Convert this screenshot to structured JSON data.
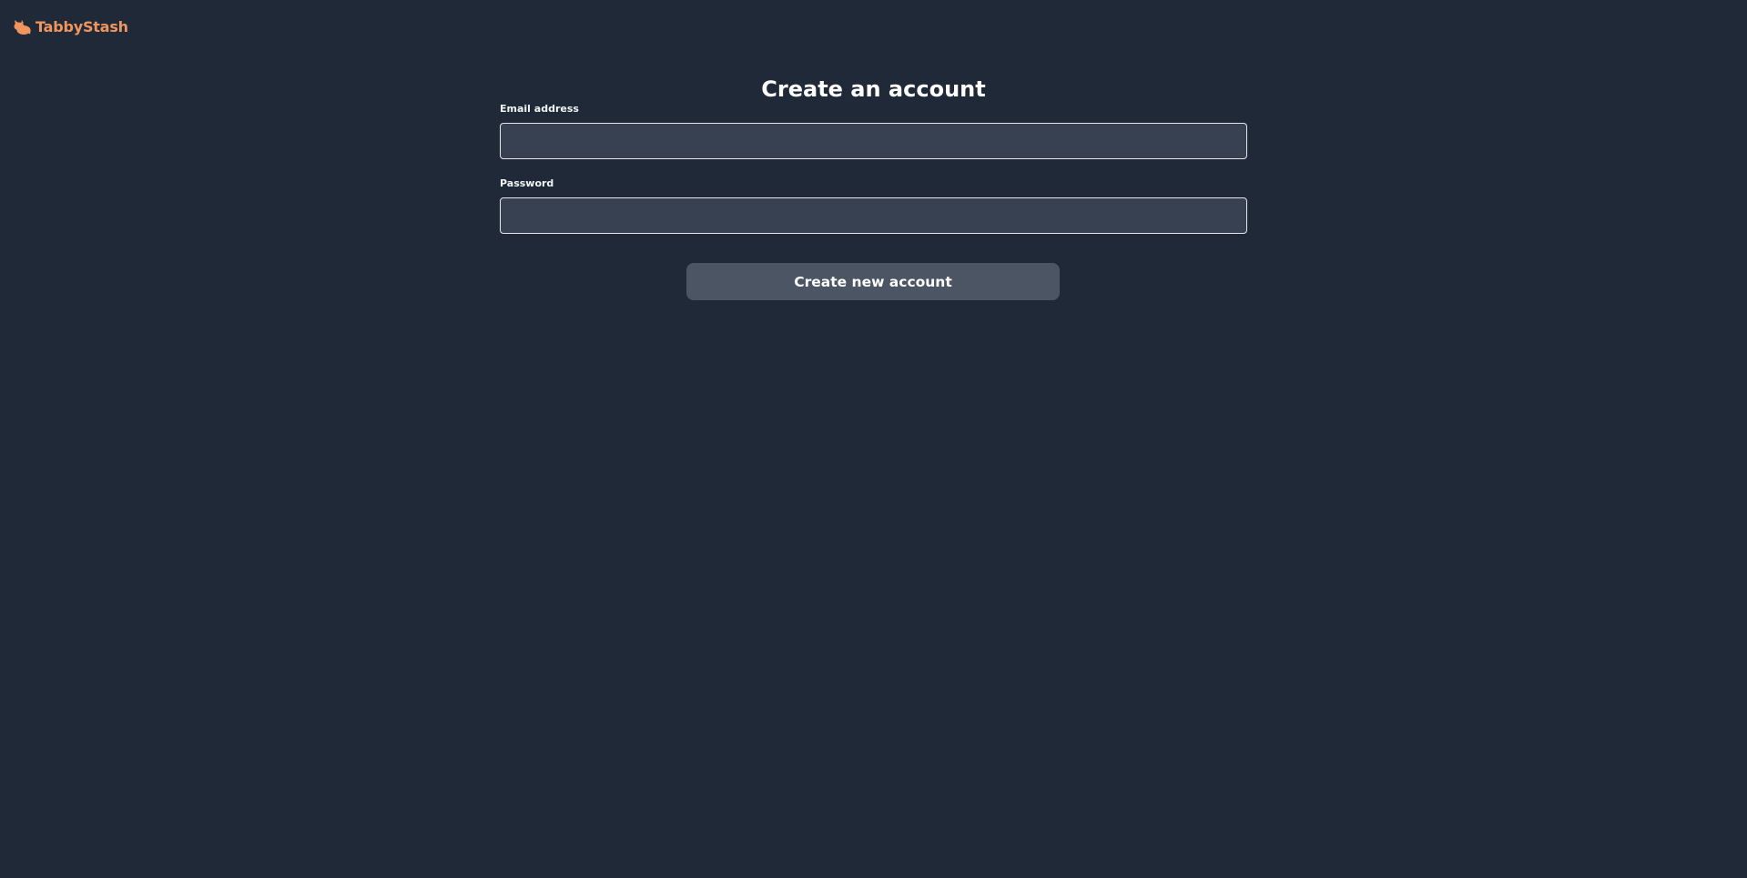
{
  "brand": {
    "name": "TabbyStash",
    "icon": "cat-icon",
    "color": "#f0955e"
  },
  "page": {
    "title": "Create an account",
    "background": "#1f2937"
  },
  "form": {
    "email": {
      "label": "Email address",
      "value": ""
    },
    "password": {
      "label": "Password",
      "value": ""
    },
    "submit_label": "Create new account"
  }
}
